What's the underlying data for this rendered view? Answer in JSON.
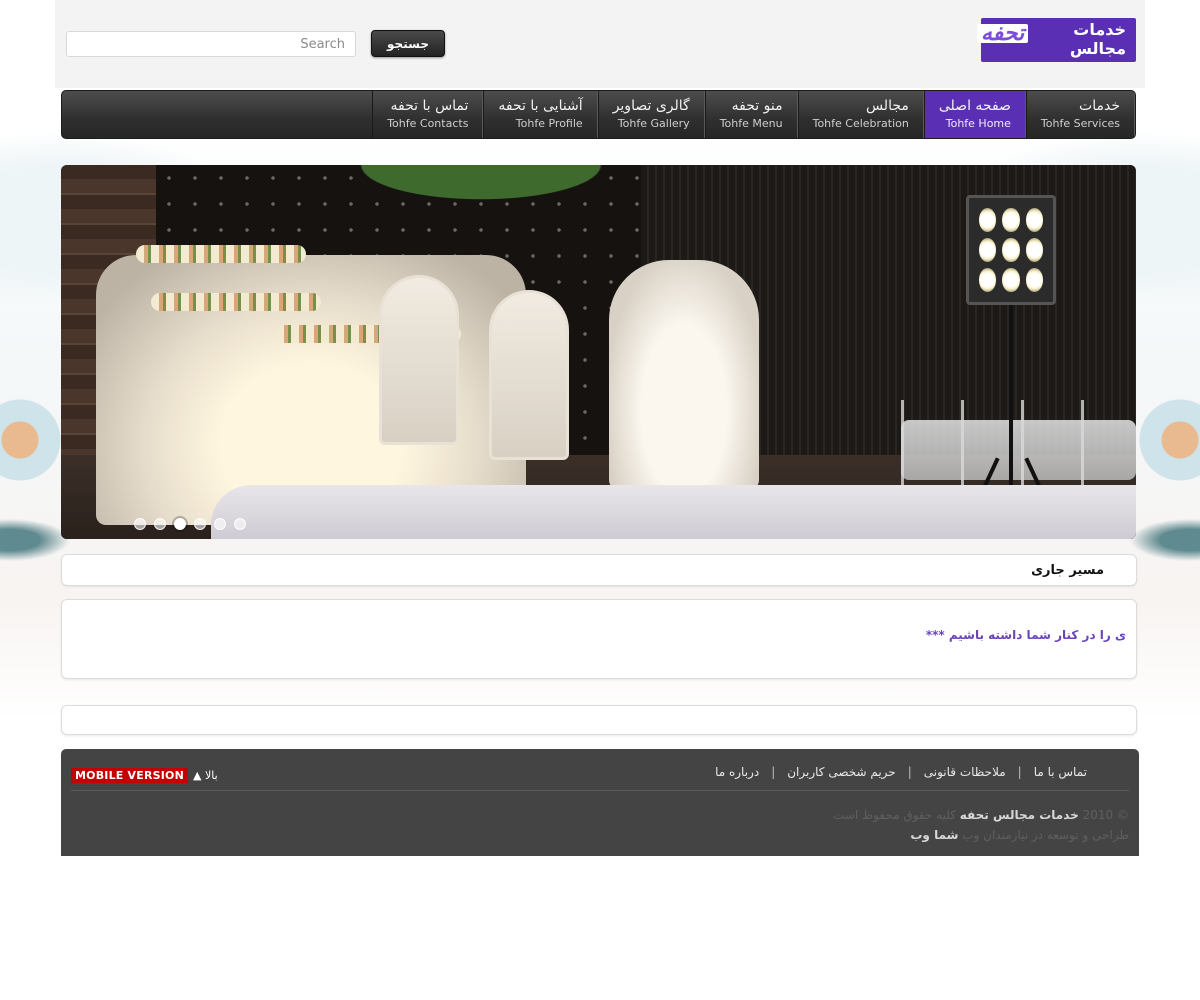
{
  "header": {
    "logo_line1": "خدمات",
    "logo_line2": "مجالس",
    "logo_script": "تحفه",
    "search_placeholder": "Search",
    "search_button": "جستجو"
  },
  "nav": {
    "items": [
      {
        "fa": "خدمات",
        "en": "Tohfe Services",
        "active": false
      },
      {
        "fa": "صفحه اصلی",
        "en": "Tohfe Home",
        "active": true
      },
      {
        "fa": "مجالس",
        "en": "Tohfe Celebration",
        "active": false
      },
      {
        "fa": "منو تحفه",
        "en": "Tohfe Menu",
        "active": false
      },
      {
        "fa": "گالری تصاویر",
        "en": "Tohfe Gallery",
        "active": false
      },
      {
        "fa": "آشنایی با تحفه",
        "en": "Tohfe Profile",
        "active": false
      },
      {
        "fa": "تماس با تحفه",
        "en": "Tohfe Contacts",
        "active": false
      }
    ]
  },
  "slider": {
    "slide_count": 6,
    "active_index": 2
  },
  "breadcrumb": {
    "label": "مسیر جاری"
  },
  "content": {
    "text": "ی را در کنار شما داشته باشیم ***"
  },
  "footer": {
    "links": [
      "درباره ما",
      "حریم شخصی کاربران",
      "ملاحظات قانونی",
      "تماس با ما"
    ],
    "mobile_version": "MOBILE VERSION",
    "to_top": "بالا ▲",
    "copyright_prefix": "© 2010",
    "copyright_brand": "خدمات مجالس تحفه",
    "copyright_suffix": "کلیه حقوق محفوظ است",
    "design_prefix": "طراحی و توسعه در نیازمندان وب",
    "design_brand": "شما وب"
  },
  "colors": {
    "accent": "#5b2fb3",
    "nav_bg": "#333333",
    "footer_bg": "#444444",
    "mobile_badge": "#c40000"
  }
}
